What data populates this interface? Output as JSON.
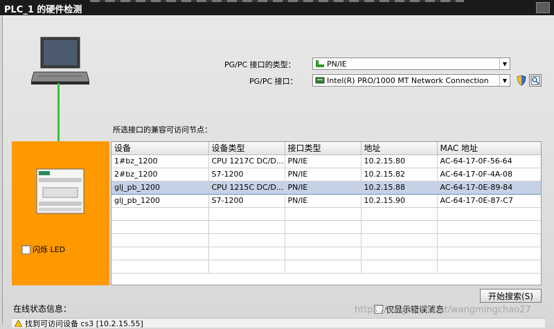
{
  "window": {
    "title": "PLC_1 的硬件检测"
  },
  "interface": {
    "type_label": "PG/PC 接口的类型：",
    "type_value": "PN/IE",
    "iface_label": "PG/PC 接口：",
    "iface_value": "Intel(R) PRO/1000 MT Network Connection"
  },
  "nodes_label": "所选接口的兼容可访问节点：",
  "table": {
    "headers": [
      "设备",
      "设备类型",
      "接口类型",
      "地址",
      "MAC 地址"
    ],
    "rows": [
      [
        "1#bz_1200",
        "CPU 1217C DC/D...",
        "PN/IE",
        "10.2.15.80",
        "AC-64-17-0F-56-64"
      ],
      [
        "2#bz_1200",
        "S7-1200",
        "PN/IE",
        "10.2.15.82",
        "AC-64-17-0F-4A-08"
      ],
      [
        "glj_pb_1200",
        "CPU 1215C DC/D...",
        "PN/IE",
        "10.2.15.88",
        "AC-64-17-0E-89-84"
      ],
      [
        "glj_pb_1200",
        "S7-1200",
        "PN/IE",
        "10.2.15.90",
        "AC-64-17-0E-87-C7"
      ]
    ],
    "selected_row": 2
  },
  "flash_led_label": "闪烁 LED",
  "start_search_label": "开始搜索(S)",
  "online_status_label": "在线状态信息：",
  "errors_only_label": "仅显示错误消息",
  "status_message": "找到可访问设备 cs3 [10.2.15.55]",
  "watermark": "https://blog.csdn.net/wangmingchao27",
  "colors": {
    "device_panel": "#ff9900",
    "link_line": "#36c436",
    "selected_row": "#c5d2e6"
  },
  "icons": {
    "close": "close-icon",
    "ethernet": "ethernet-icon",
    "nic": "network-card-icon",
    "shield": "shield-icon",
    "diagnose": "diagnose-icon",
    "warning": "warning-icon"
  }
}
